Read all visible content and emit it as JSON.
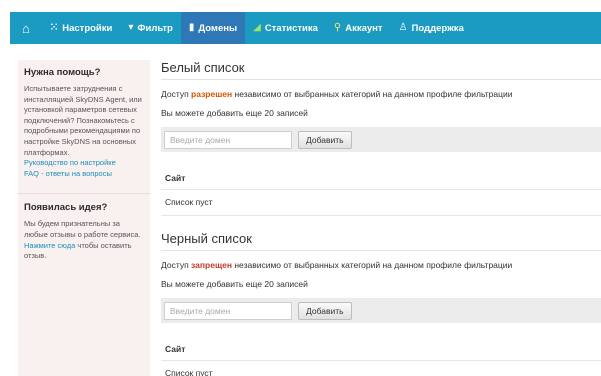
{
  "nav": {
    "items": [
      {
        "icon": "grid-icon",
        "label": "Настройки"
      },
      {
        "icon": "funnel-icon",
        "label": "Фильтр"
      },
      {
        "icon": "document-icon",
        "label": "Домены"
      },
      {
        "icon": "chart-icon",
        "label": "Статистика"
      },
      {
        "icon": "person-icon",
        "label": "Аккаунт"
      },
      {
        "icon": "support-icon",
        "label": "Поддержка"
      }
    ],
    "active_label": "Домены"
  },
  "sidebar": {
    "help": {
      "title": "Нужна помощь?",
      "text": "Испытываете затруднения с инсталляцией SkyDNS Agent, или установкой параметров сетевых подключений? Познакомьтесь с подробными рекомендациями по настройке SkyDNS на основных платформах.",
      "links": [
        "Руководство по настройке",
        "FAQ - ответы на вопросы"
      ]
    },
    "idea": {
      "title": "Появилась идея?",
      "text_before": "Мы будем признательны за любые отзывы о работе сервиса. ",
      "link": "Нажмите сюда",
      "text_after": " чтобы оставить отзыв."
    }
  },
  "whitelist": {
    "title": "Белый список",
    "desc_prefix": "Доступ ",
    "desc_highlight": "разрешен",
    "desc_suffix": " независимо от выбранных категорий на данном профиле фильтрации",
    "remaining": "Вы можете добавить еще 20 записей",
    "input_placeholder": "Введите домен",
    "add_label": "Добавить",
    "column": "Сайт",
    "empty": "Список пуст"
  },
  "blacklist": {
    "title": "Черный список",
    "desc_prefix": "Доступ ",
    "desc_highlight": "запрещен",
    "desc_suffix": " независимо от выбранных категорий на данном профиле фильтрации",
    "remaining": "Вы можете добавить еще 20 записей",
    "input_placeholder": "Введите домен",
    "add_label": "Добавить",
    "column": "Сайт",
    "empty": "Список пуст"
  },
  "colors": {
    "nav_bg": "#1b9bc1",
    "nav_active": "#2e78b8",
    "sidebar_bg": "#f9f1f0",
    "link": "#1a8dba",
    "allowed": "#d45500",
    "denied": "#c0392b"
  }
}
